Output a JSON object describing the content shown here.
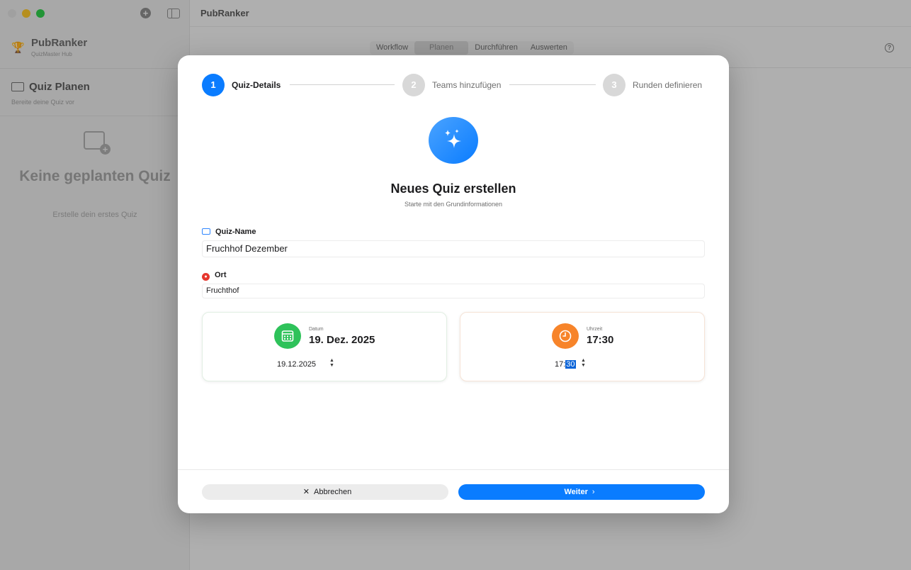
{
  "window": {
    "title": "PubRanker"
  },
  "sidebar": {
    "brand_name": "PubRanker",
    "brand_sub": "QuizMaster Hub",
    "section_title": "Quiz Planen",
    "section_sub": "Bereite deine Quiz vor",
    "empty_title": "Keine geplanten Quiz",
    "empty_sub": "Erstelle dein erstes Quiz"
  },
  "segmented": {
    "items": [
      "Workflow",
      "Planen",
      "Durchführen",
      "Auswerten"
    ],
    "selected": "Planen"
  },
  "modal": {
    "steps": [
      {
        "number": "1",
        "label": "Quiz-Details"
      },
      {
        "number": "2",
        "label": "Teams hinzufügen"
      },
      {
        "number": "3",
        "label": "Runden definieren"
      }
    ],
    "active_step": 1,
    "title": "Neues Quiz erstellen",
    "subtitle": "Starte mit den Grundinformationen",
    "name_label": "Quiz-Name",
    "name_value": "Fruchhof Dezember",
    "location_label": "Ort",
    "location_value": "Fruchthof",
    "date": {
      "caption": "Datum",
      "display": "19. Dez. 2025",
      "field": "19.12.2025"
    },
    "time": {
      "caption": "Uhrzeit",
      "display": "17:30",
      "hour": "17:",
      "minute": "30"
    },
    "cancel_label": "Abbrechen",
    "next_label": "Weiter"
  },
  "icons": {
    "close": "close-icon",
    "chevron": "chevron-right-icon"
  },
  "colors": {
    "accent": "#0a7cff",
    "date_badge": "#2ec25a",
    "time_badge": "#f7842a",
    "location_pin": "#e6372e"
  }
}
